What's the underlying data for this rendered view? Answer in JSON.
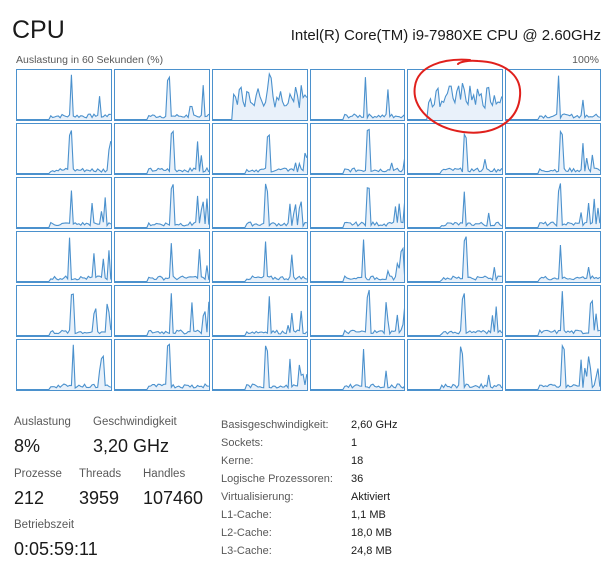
{
  "header": {
    "title": "CPU",
    "cpu_model": "Intel(R) Core(TM) i9-7980XE CPU @ 2.60GHz"
  },
  "graph": {
    "label": "Auslastung in 60 Sekunden (%)",
    "max_label": "100%",
    "cores": 36,
    "columns": 6,
    "line_color": "#4b91cd",
    "fill_color": "#e9f1fa",
    "border_color": "#4b91cd",
    "annotation_color": "#e0201c"
  },
  "stats": {
    "utilization_label": "Auslastung",
    "utilization_value": "8%",
    "speed_label": "Geschwindigkeit",
    "speed_value": "3,20 GHz",
    "processes_label": "Prozesse",
    "processes_value": "212",
    "threads_label": "Threads",
    "threads_value": "3959",
    "handles_label": "Handles",
    "handles_value": "107460",
    "uptime_label": "Betriebszeit",
    "uptime_value": "0:05:59:11"
  },
  "details": [
    {
      "key": "Basisgeschwindigkeit:",
      "value": "2,60 GHz"
    },
    {
      "key": "Sockets:",
      "value": "1"
    },
    {
      "key": "Kerne:",
      "value": "18"
    },
    {
      "key": "Logische Prozessoren:",
      "value": "36"
    },
    {
      "key": "Virtualisierung:",
      "value": "Aktiviert"
    },
    {
      "key": "L1-Cache:",
      "value": "1,1 MB"
    },
    {
      "key": "L2-Cache:",
      "value": "18,0 MB"
    },
    {
      "key": "L3-Cache:",
      "value": "24,8 MB"
    }
  ]
}
